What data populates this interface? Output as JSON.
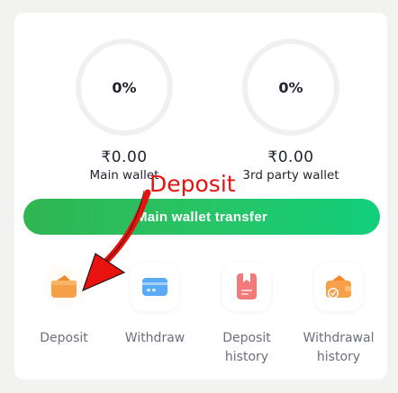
{
  "wallets": [
    {
      "percent": "0%",
      "amount": "₹0.00",
      "label": "Main wallet"
    },
    {
      "percent": "0%",
      "amount": "₹0.00",
      "label": "3rd party wallet"
    }
  ],
  "transfer_button": {
    "label": "Main wallet transfer"
  },
  "actions": [
    {
      "label": "Deposit",
      "icon": "wallet-icon"
    },
    {
      "label": "Withdraw",
      "icon": "card-icon"
    },
    {
      "label": "Deposit history",
      "icon": "deposit-history-icon"
    },
    {
      "label": "Withdrawal history",
      "icon": "withdrawal-history-icon"
    }
  ],
  "annotation": {
    "text": "Deposit",
    "color": "#e8120f"
  },
  "colors": {
    "accent_green": "#28c465",
    "icon_orange": "#f6a04a",
    "icon_blue": "#4ea3f5",
    "icon_red": "#f06b6b"
  }
}
